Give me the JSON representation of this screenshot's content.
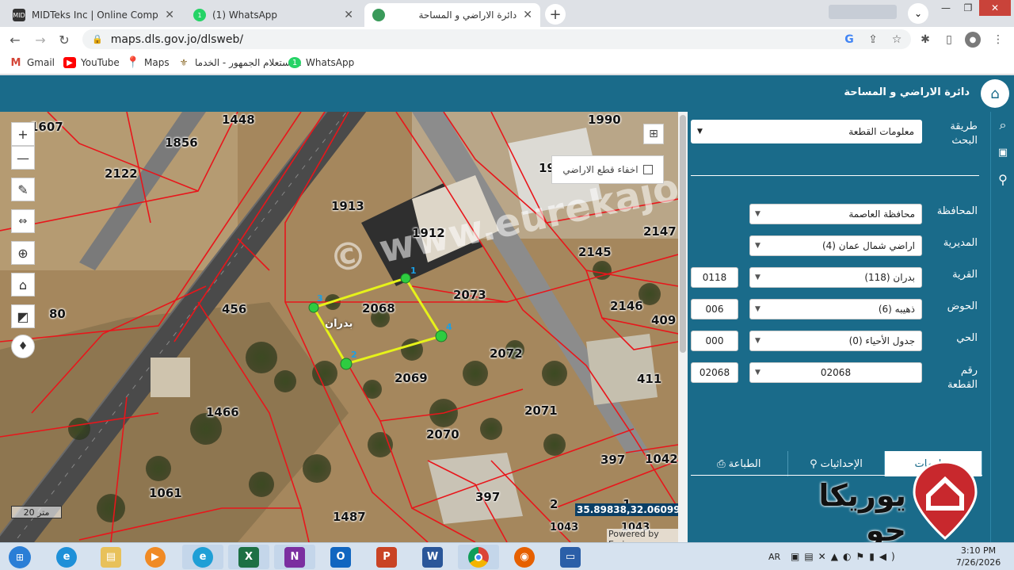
{
  "browser": {
    "tabs": [
      {
        "label": "MIDTeks Inc | Online Computer S",
        "favicon": "MID",
        "active": false
      },
      {
        "label": "(1) WhatsApp",
        "favicon": "1",
        "active": false
      },
      {
        "label": "دائرة الاراضي و المساحة",
        "favicon": "",
        "active": true
      }
    ],
    "url": "maps.dls.gov.jo/dlsweb/",
    "bookmarks": [
      "Gmail",
      "YouTube",
      "Maps",
      "استعلام الجمهور - الخدما...",
      "WhatsApp"
    ]
  },
  "app": {
    "title": "دائرة الاراضي و المساحة"
  },
  "map": {
    "hide_parcels_label": "اخفاء قطع الاراضي",
    "scale_label": "20 متر",
    "coords": "35.89838,32.06099",
    "attribution": "Powered by Esri",
    "watermark": "© www.eurekajo.com",
    "village_label": "بدران",
    "parcels": [
      "1607",
      "1448",
      "1990",
      "1856",
      "2122",
      "19",
      "1913",
      "1912",
      "2147",
      "2145",
      "2068",
      "2073",
      "2146",
      "80",
      "456",
      "2072",
      "409",
      "2069",
      "411",
      "1466",
      "2071",
      "2070",
      "397",
      "1042",
      "1061",
      "397",
      "1487",
      "2",
      "1043",
      "1043",
      "1"
    ],
    "vertices": [
      "1",
      "2",
      "3",
      "4"
    ]
  },
  "panel": {
    "search_method_label": "طريقة البحث",
    "search_method_value": "معلومات القطعة",
    "fields": [
      {
        "label": "المحافظة",
        "value": "محافظة العاصمة",
        "code": ""
      },
      {
        "label": "المديرية",
        "value": "اراضي شمال عمان (4)",
        "code": ""
      },
      {
        "label": "القرية",
        "value": "بدران (118)",
        "code": "0118"
      },
      {
        "label": "الحوض",
        "value": "ذهيبه (6)",
        "code": "006"
      },
      {
        "label": "الحي",
        "value": "جدول الأحياء (0)",
        "code": "000"
      },
      {
        "label": "رقم القطعة",
        "value": "02068",
        "code": "02068"
      }
    ],
    "tabs": [
      "الطباعة",
      "الإحداثيات",
      "معلومات"
    ],
    "brand": "يوريكا جو"
  },
  "taskbar": {
    "lang": "AR",
    "time": "3:10 PM",
    "date": "7/26/2026"
  }
}
